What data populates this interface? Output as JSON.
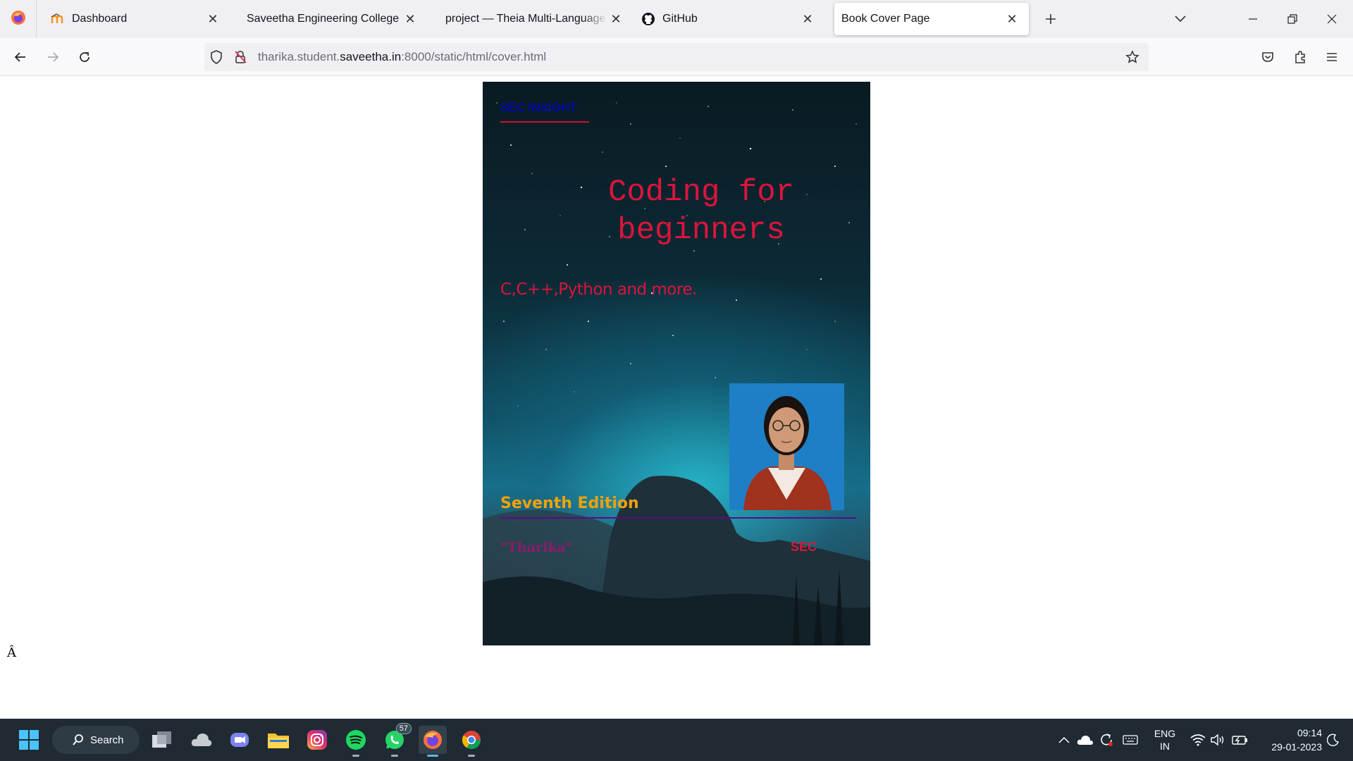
{
  "browser": {
    "tabs": [
      {
        "title": "Dashboard",
        "icon": "moodle-icon",
        "active": false
      },
      {
        "title": "Saveetha Engineering College",
        "icon": "none",
        "active": false
      },
      {
        "title": "project — Theia Multi-Language Explorer",
        "icon": "none",
        "active": false
      },
      {
        "title": "GitHub",
        "icon": "github-icon",
        "active": false
      },
      {
        "title": "Book Cover Page",
        "icon": "none",
        "active": true
      }
    ],
    "url": {
      "prefix": "tharika.student.",
      "domain": "saveetha.in",
      "suffix": ":8000/static/html/cover.html"
    }
  },
  "cover": {
    "brand": "SEC INSIGHT",
    "title_line1": "Coding for",
    "title_line2": "beginners",
    "subtitle": "C,C++,Python and more.",
    "edition": "Seventh Edition",
    "author": "\"Tharika\"",
    "publisher": "SEC"
  },
  "page": {
    "stray_char": "Â"
  },
  "taskbar": {
    "search_label": "Search",
    "whatsapp_badge": "57",
    "lang_line1": "ENG",
    "lang_line2": "IN",
    "time": "09:14",
    "date": "29-01-2023"
  },
  "colors": {
    "title": "#dc143c",
    "brand_link": "#0000ee",
    "edition": "#f2a20a",
    "author": "#8e1b6a",
    "taskbar": "#1f2a33"
  }
}
